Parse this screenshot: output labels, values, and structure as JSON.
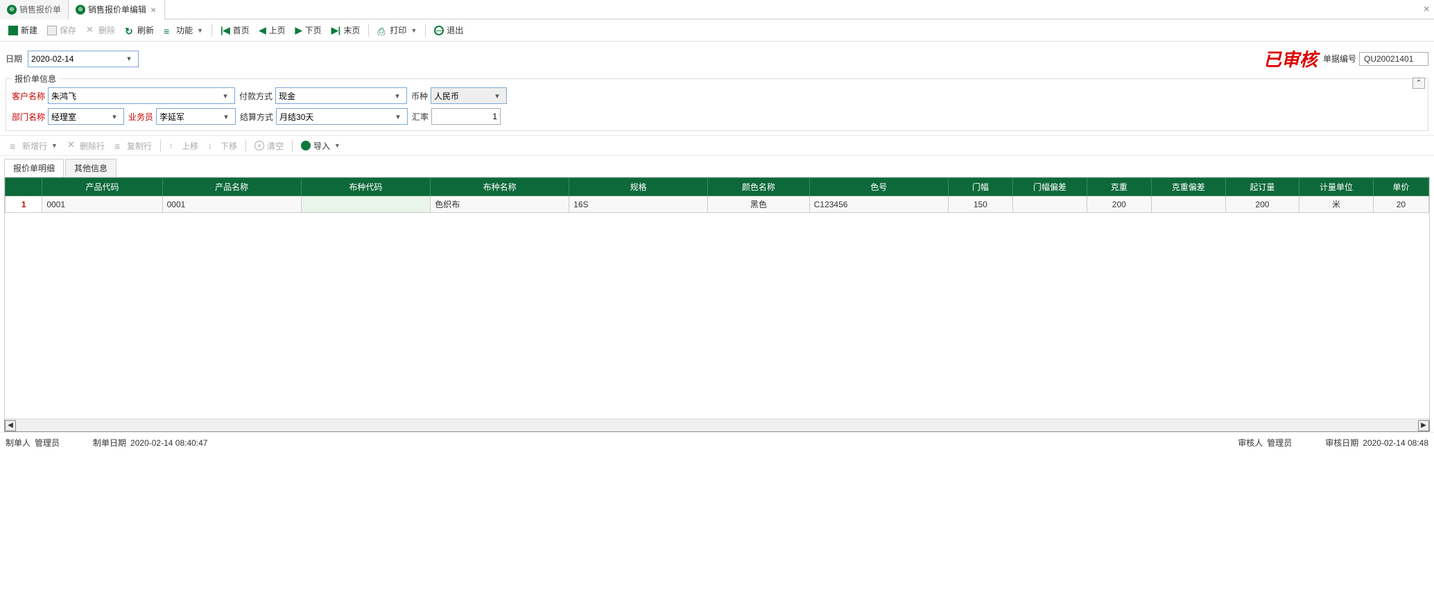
{
  "tabs": {
    "t0": "销售报价单",
    "t1": "销售报价单编辑"
  },
  "toolbar": {
    "new": "新建",
    "save": "保存",
    "delete": "删除",
    "refresh": "刷新",
    "func": "功能",
    "first": "首页",
    "prev": "上页",
    "next": "下页",
    "last": "末页",
    "print": "打印",
    "exit": "退出"
  },
  "header": {
    "date_label": "日期",
    "date_value": "2020-02-14",
    "stamp": "已审核",
    "docno_label": "单据编号",
    "docno_value": "QU20021401"
  },
  "info": {
    "title": "报价单信息",
    "customer_label": "客户名称",
    "customer_value": "朱鸿飞",
    "pay_label": "付款方式",
    "pay_value": "现金",
    "currency_label": "币种",
    "currency_value": "人民币",
    "dept_label": "部门名称",
    "dept_value": "经理室",
    "sales_label": "业务员",
    "sales_value": "李延军",
    "settle_label": "结算方式",
    "settle_value": "月结30天",
    "rate_label": "汇率",
    "rate_value": "1"
  },
  "subtoolbar": {
    "addrow": "新增行",
    "delrow": "删除行",
    "copyrow": "复制行",
    "moveup": "上移",
    "movedown": "下移",
    "clear": "清空",
    "import": "导入"
  },
  "subtabs": {
    "detail": "报价单明细",
    "other": "其他信息"
  },
  "grid": {
    "headers": {
      "prod_code": "产品代码",
      "prod_name": "产品名称",
      "cloth_code": "布种代码",
      "cloth_name": "布种名称",
      "spec": "规格",
      "color_name": "颜色名称",
      "color_no": "色号",
      "width": "门幅",
      "width_dev": "门幅偏差",
      "weight": "克重",
      "weight_dev": "克重偏差",
      "moq": "起订量",
      "unit": "计量单位",
      "price": "单价"
    },
    "row1": {
      "idx": "1",
      "prod_code": "0001",
      "prod_name": "0001",
      "cloth_code": "",
      "cloth_name": "色织布",
      "spec": "16S",
      "color_name": "黑色",
      "color_no": "C123456",
      "width": "150",
      "width_dev": "",
      "weight": "200",
      "weight_dev": "",
      "moq": "200",
      "unit": "米",
      "price": "20"
    }
  },
  "footer": {
    "creator_label": "制单人",
    "creator_value": "管理员",
    "create_date_label": "制单日期",
    "create_date_value": "2020-02-14 08:40:47",
    "auditor_label": "审核人",
    "auditor_value": "管理员",
    "audit_date_label": "审核日期",
    "audit_date_value": "2020-02-14 08:48"
  }
}
